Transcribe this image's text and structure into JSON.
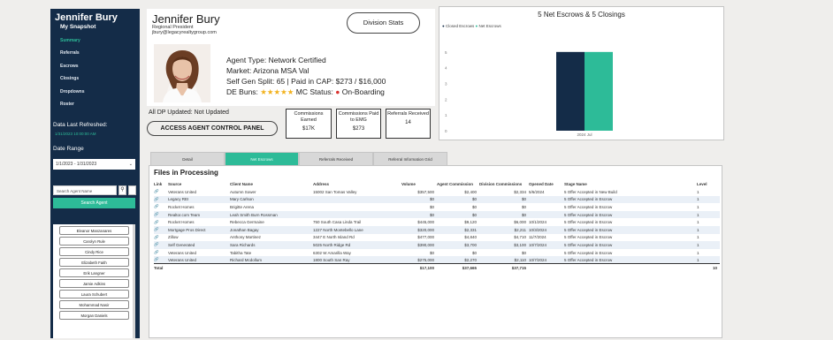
{
  "sidebar": {
    "agent_name": "Jennifer Bury",
    "nav": [
      {
        "label": "My Snapshot"
      },
      {
        "label": "Summary"
      },
      {
        "label": "Referrals"
      },
      {
        "label": "Escrows"
      },
      {
        "label": "Closings"
      },
      {
        "label": "Dropdowns"
      },
      {
        "label": "Roster"
      }
    ],
    "data_last_refreshed_label": "Data Last Refreshed:",
    "data_last_refreshed_value": "1/31/2023 10:00:00 AM",
    "date_range_label": "Date Range",
    "date_range_value": "1/1/2023 - 1/31/2023",
    "search_placeholder": "Search Agent Name",
    "search_button": "Search Agent",
    "agents": [
      "Eleanor Manzanares",
      "Carolyn Rule",
      "Cindy Rice",
      "Elizabeth Faith",
      "Erik Langner",
      "Jamie Adkins",
      "Laura Schubert",
      "Mohammad Nasir",
      "Morgan Daniels"
    ],
    "accent": "#2dbb98",
    "bg": "#142c48"
  },
  "header": {
    "name": "Jennifer Bury",
    "title": "Regional President",
    "email": "jbury@legacyrealtygroup.com",
    "division_stats_label": "Division Stats",
    "agent_type": "Agent Type: Network Certified",
    "market": "Market: Arizona MSA Val",
    "split": "Self Gen Split: 65 | Paid in CAP: $273 / $16,000",
    "de_label": "DE Buns:",
    "stars": 5,
    "mc_label": "MC Status:",
    "mc_value": "On-Boarding",
    "dp_note": "All DP Updated: Not Updated",
    "access_button": "ACCESS AGENT CONTROL PANEL"
  },
  "stats": [
    {
      "label": "Commissions Earned",
      "value": "$17K"
    },
    {
      "label": "Commissions Paid to EMG",
      "value": "$273"
    },
    {
      "label": "Referrals Received",
      "value": "14"
    }
  ],
  "chart_data": {
    "type": "bar",
    "title": "5 Net Escrows & 5 Closings",
    "categories": [
      "2024 Jul"
    ],
    "series": [
      {
        "name": "Closed Escrows",
        "values": [
          5
        ],
        "color": "#142c48"
      },
      {
        "name": "Net Escrows",
        "values": [
          5
        ],
        "color": "#2dbb98"
      }
    ],
    "ylim": [
      0,
      6
    ],
    "yticks": [
      0,
      1,
      2,
      3,
      4,
      5
    ],
    "legend": "top-left",
    "grid": false
  },
  "tabs": [
    {
      "label": "Detail",
      "active": false
    },
    {
      "label": "Net Escrows",
      "active": true
    },
    {
      "label": "Referrals Received",
      "active": false
    },
    {
      "label": "Referral Information Grid",
      "active": false
    }
  ],
  "table": {
    "title": "Files in Processing",
    "columns": [
      "Link",
      "Source",
      "Client Name",
      "Address",
      "Volume",
      "Agent Commission",
      "Division Commissions",
      "Opened Date",
      "Stage Name",
      "Level"
    ],
    "rows": [
      [
        "🔗",
        "Veterans United",
        "Autumn Sower",
        "15002 San Tomas Valley",
        "$357,500",
        "$2,400",
        "$2,334",
        "5/6/2024",
        "5 Offer Accepted in New Build",
        "1"
      ],
      [
        "🔗",
        "Legacy REI",
        "Mary Carlson",
        "",
        "$0",
        "$0",
        "$0",
        "",
        "5 Offer Accepted in Escrow",
        "1"
      ],
      [
        "🔗",
        "Rocket Homes",
        "Brigitte Arena",
        "",
        "$0",
        "$0",
        "$0",
        "",
        "5 Offer Accepted in Escrow",
        "1"
      ],
      [
        "🔗",
        "Realtor.com Team",
        "Leah Smith Burn Rossman",
        "",
        "$0",
        "$0",
        "$0",
        "",
        "5 Offer Accepted in Escrow",
        "1"
      ],
      [
        "🔗",
        "Rocket Homes",
        "Rebecca Germaine",
        "750 South Casa Linda Trail",
        "$445,000",
        "$9,120",
        "$6,000",
        "10/1/2024",
        "5 Offer Accepted in Escrow",
        "1"
      ],
      [
        "🔗",
        "Mortgage Pros Direct",
        "Jonathan Bagay",
        "1227 North Montebello Lane",
        "$320,000",
        "$2,331",
        "$2,211",
        "10/3/2024",
        "5 Offer Accepted in Escrow",
        "1"
      ],
      [
        "🔗",
        "Zillow",
        "Anthony Martinez",
        "3447 E North Island Rd",
        "$477,000",
        "$4,840",
        "$4,710",
        "11/7/2024",
        "5 Offer Accepted in Escrow",
        "1"
      ],
      [
        "🔗",
        "Self Generated",
        "Sara Richards",
        "5025 North Ridge Rd",
        "$390,000",
        "$3,700",
        "$3,100",
        "10/7/2024",
        "5 Offer Accepted in Escrow",
        "1"
      ],
      [
        "🔗",
        "Veterans United",
        "Tabitha Tate",
        "6302 W Amarilla Way",
        "$0",
        "$0",
        "$0",
        "",
        "5 Offer Accepted in Escrow",
        "1"
      ],
      [
        "🔗",
        "Veterans United",
        "Richard Mcdollum",
        "1800 South San Ray",
        "$275,000",
        "$2,270",
        "$2,110",
        "10/7/2024",
        "5 Offer Accepted in Escrow",
        "1"
      ]
    ],
    "total": {
      "label": "Total",
      "volume": "$17,100",
      "agent_commission": "$37,665",
      "division_commissions": "$37,715",
      "level": "10"
    }
  }
}
